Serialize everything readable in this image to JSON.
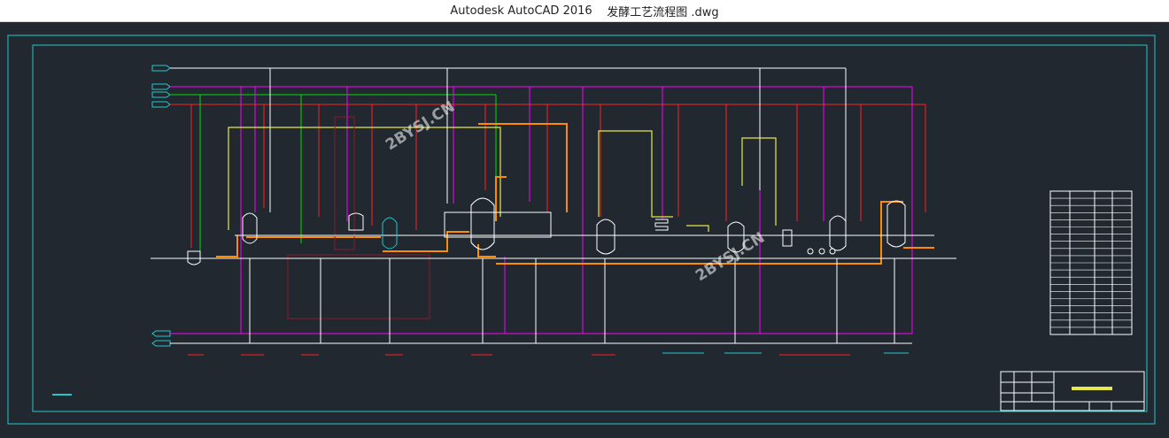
{
  "window": {
    "app_name": "Autodesk AutoCAD 2016",
    "file_name": "发酵工艺流程图 .dwg"
  },
  "watermarks": [
    "2BYSJ.CN",
    "2BYSJ.CN"
  ],
  "colors": {
    "background": "#212830",
    "frame": "#22c7c9",
    "steam_line": "#ff00ff",
    "cooling_line": "#ff2020",
    "air_line": "#00e000",
    "feed_line": "#e8e84a",
    "product_line": "#ff8c00",
    "equipment": "#ffffff",
    "drain_line": "#8b1a2a"
  },
  "drawing_stats": {
    "vessel_count": 8,
    "parts_table_rows": 20
  }
}
